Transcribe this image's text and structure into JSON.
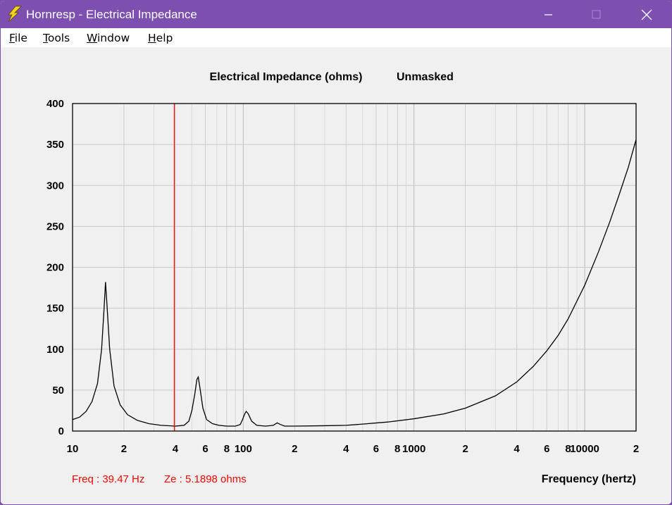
{
  "window": {
    "title": "Hornresp - Electrical Impedance",
    "controls": [
      "minimize-button",
      "maximize-button",
      "close-button"
    ]
  },
  "menu": {
    "items": [
      {
        "label": "File",
        "accel": "F",
        "rest": "ile"
      },
      {
        "label": "Tools",
        "accel": "T",
        "rest": "ools"
      },
      {
        "label": "Window",
        "accel": "W",
        "rest": "indow"
      },
      {
        "label": "Help",
        "accel": "H",
        "rest": "elp"
      }
    ]
  },
  "chart_data": {
    "type": "line",
    "title": "Electrical Impedance (ohms)",
    "title_mask": "Unmasked",
    "xlabel": "Frequency (hertz)",
    "ylabel": "",
    "x_scale": "log",
    "xlim": [
      10,
      20000
    ],
    "ylim": [
      0,
      400
    ],
    "y_ticks": [
      0,
      50,
      100,
      150,
      200,
      250,
      300,
      350,
      400
    ],
    "x_tick_labels": [
      {
        "value": 10,
        "label": "10"
      },
      {
        "value": 20,
        "label": "2"
      },
      {
        "value": 40,
        "label": "4"
      },
      {
        "value": 60,
        "label": "6"
      },
      {
        "value": 80,
        "label": "8"
      },
      {
        "value": 100,
        "label": "100"
      },
      {
        "value": 200,
        "label": "2"
      },
      {
        "value": 400,
        "label": "4"
      },
      {
        "value": 600,
        "label": "6"
      },
      {
        "value": 800,
        "label": "8"
      },
      {
        "value": 1000,
        "label": "1000"
      },
      {
        "value": 2000,
        "label": "2"
      },
      {
        "value": 4000,
        "label": "4"
      },
      {
        "value": 6000,
        "label": "6"
      },
      {
        "value": 8000,
        "label": "8"
      },
      {
        "value": 10000,
        "label": "10000"
      },
      {
        "value": 20000,
        "label": "2"
      }
    ],
    "grid": true,
    "series": [
      {
        "color": "#000000",
        "points": [
          [
            10,
            14
          ],
          [
            11,
            17
          ],
          [
            12,
            24
          ],
          [
            13,
            36
          ],
          [
            14,
            58
          ],
          [
            14.8,
            100
          ],
          [
            15.3,
            150
          ],
          [
            15.6,
            182
          ],
          [
            15.9,
            155
          ],
          [
            16.5,
            100
          ],
          [
            17.5,
            55
          ],
          [
            19,
            32
          ],
          [
            21,
            20
          ],
          [
            24,
            13
          ],
          [
            28,
            9
          ],
          [
            33,
            7
          ],
          [
            40,
            6
          ],
          [
            45,
            7
          ],
          [
            48,
            12
          ],
          [
            50,
            25
          ],
          [
            52,
            45
          ],
          [
            53.5,
            63
          ],
          [
            54.5,
            66
          ],
          [
            56,
            50
          ],
          [
            58,
            28
          ],
          [
            61,
            14
          ],
          [
            66,
            9
          ],
          [
            72,
            7
          ],
          [
            80,
            6
          ],
          [
            90,
            6
          ],
          [
            96,
            8
          ],
          [
            99,
            14
          ],
          [
            102,
            21
          ],
          [
            104,
            24
          ],
          [
            107,
            21
          ],
          [
            112,
            12
          ],
          [
            120,
            7
          ],
          [
            135,
            6
          ],
          [
            150,
            7
          ],
          [
            158,
            10
          ],
          [
            165,
            8
          ],
          [
            175,
            6
          ],
          [
            200,
            6
          ],
          [
            300,
            6.5
          ],
          [
            400,
            7
          ],
          [
            500,
            8.5
          ],
          [
            700,
            11
          ],
          [
            1000,
            15
          ],
          [
            1500,
            21
          ],
          [
            2000,
            28
          ],
          [
            3000,
            43
          ],
          [
            4000,
            60
          ],
          [
            5000,
            79
          ],
          [
            6000,
            98
          ],
          [
            7000,
            117
          ],
          [
            8000,
            137
          ],
          [
            10000,
            178
          ],
          [
            12000,
            218
          ],
          [
            14000,
            255
          ],
          [
            16000,
            290
          ],
          [
            18000,
            322
          ],
          [
            20000,
            356
          ]
        ]
      }
    ],
    "cursor": {
      "x": 39.47,
      "color": "#ff0000"
    },
    "readout": {
      "freq": "Freq : 39.47 Hz",
      "ze": "Ze : 5.1898 ohms",
      "color": "#ff0000"
    }
  }
}
